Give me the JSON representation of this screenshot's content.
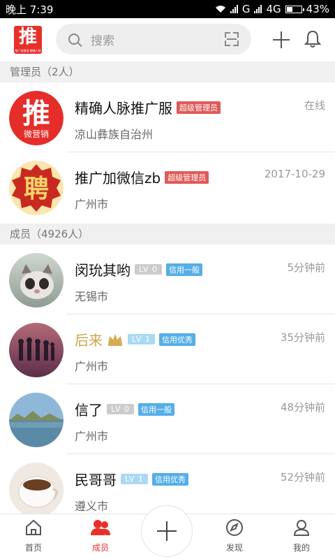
{
  "status_bar": {
    "time": "晚上 7:39",
    "network": "G",
    "network2": "4G",
    "battery": "43%",
    "battery_level": 0.43
  },
  "header": {
    "logo_text": "推",
    "logo_subtext": "推广加微信·精确人脉",
    "search_placeholder": "搜索",
    "icons": [
      "search-icon",
      "scan-icon",
      "plus-icon",
      "bell-icon"
    ]
  },
  "admins": {
    "title": "管理员（2人）",
    "items": [
      {
        "name": "精确人脉推广服",
        "tag": "超级管理员",
        "location": "凉山彝族自治州",
        "time": "在线",
        "avatar_text": "推",
        "avatar_sub": "微营销"
      },
      {
        "name": "推广加微信zb",
        "tag": "超级管理员",
        "location": "广州市",
        "time": "2017-10-29",
        "avatar_text": "聘"
      }
    ]
  },
  "members": {
    "title": "成员（4926人）",
    "items": [
      {
        "name": "闵玧其哟",
        "level": "LV 0",
        "credit": "信用一般",
        "location": "无锡市",
        "time": "5分钟前"
      },
      {
        "name": "后来",
        "level": "LV 1",
        "credit": "信用优秀",
        "location": "广州市",
        "time": "35分钟前",
        "crown": true
      },
      {
        "name": "信了",
        "level": "LV 0",
        "credit": "信用一般",
        "location": "广州市",
        "time": "48分钟前"
      },
      {
        "name": "民哥哥",
        "level": "LV 1",
        "credit": "信用优秀",
        "location": "遵义市",
        "time": "52分钟前"
      }
    ]
  },
  "bottom_nav": {
    "items": [
      {
        "label": "首页",
        "icon": "home-icon"
      },
      {
        "label": "成员",
        "icon": "members-icon",
        "active": true
      },
      {
        "label": "",
        "icon": "plus-icon"
      },
      {
        "label": "发现",
        "icon": "compass-icon"
      },
      {
        "label": "我的",
        "icon": "profile-icon"
      }
    ]
  },
  "colors": {
    "accent": "#e8302b",
    "admin_tag": "#e05a58",
    "credit_tag": "#54aee8",
    "gold_name": "#cfa54a"
  }
}
